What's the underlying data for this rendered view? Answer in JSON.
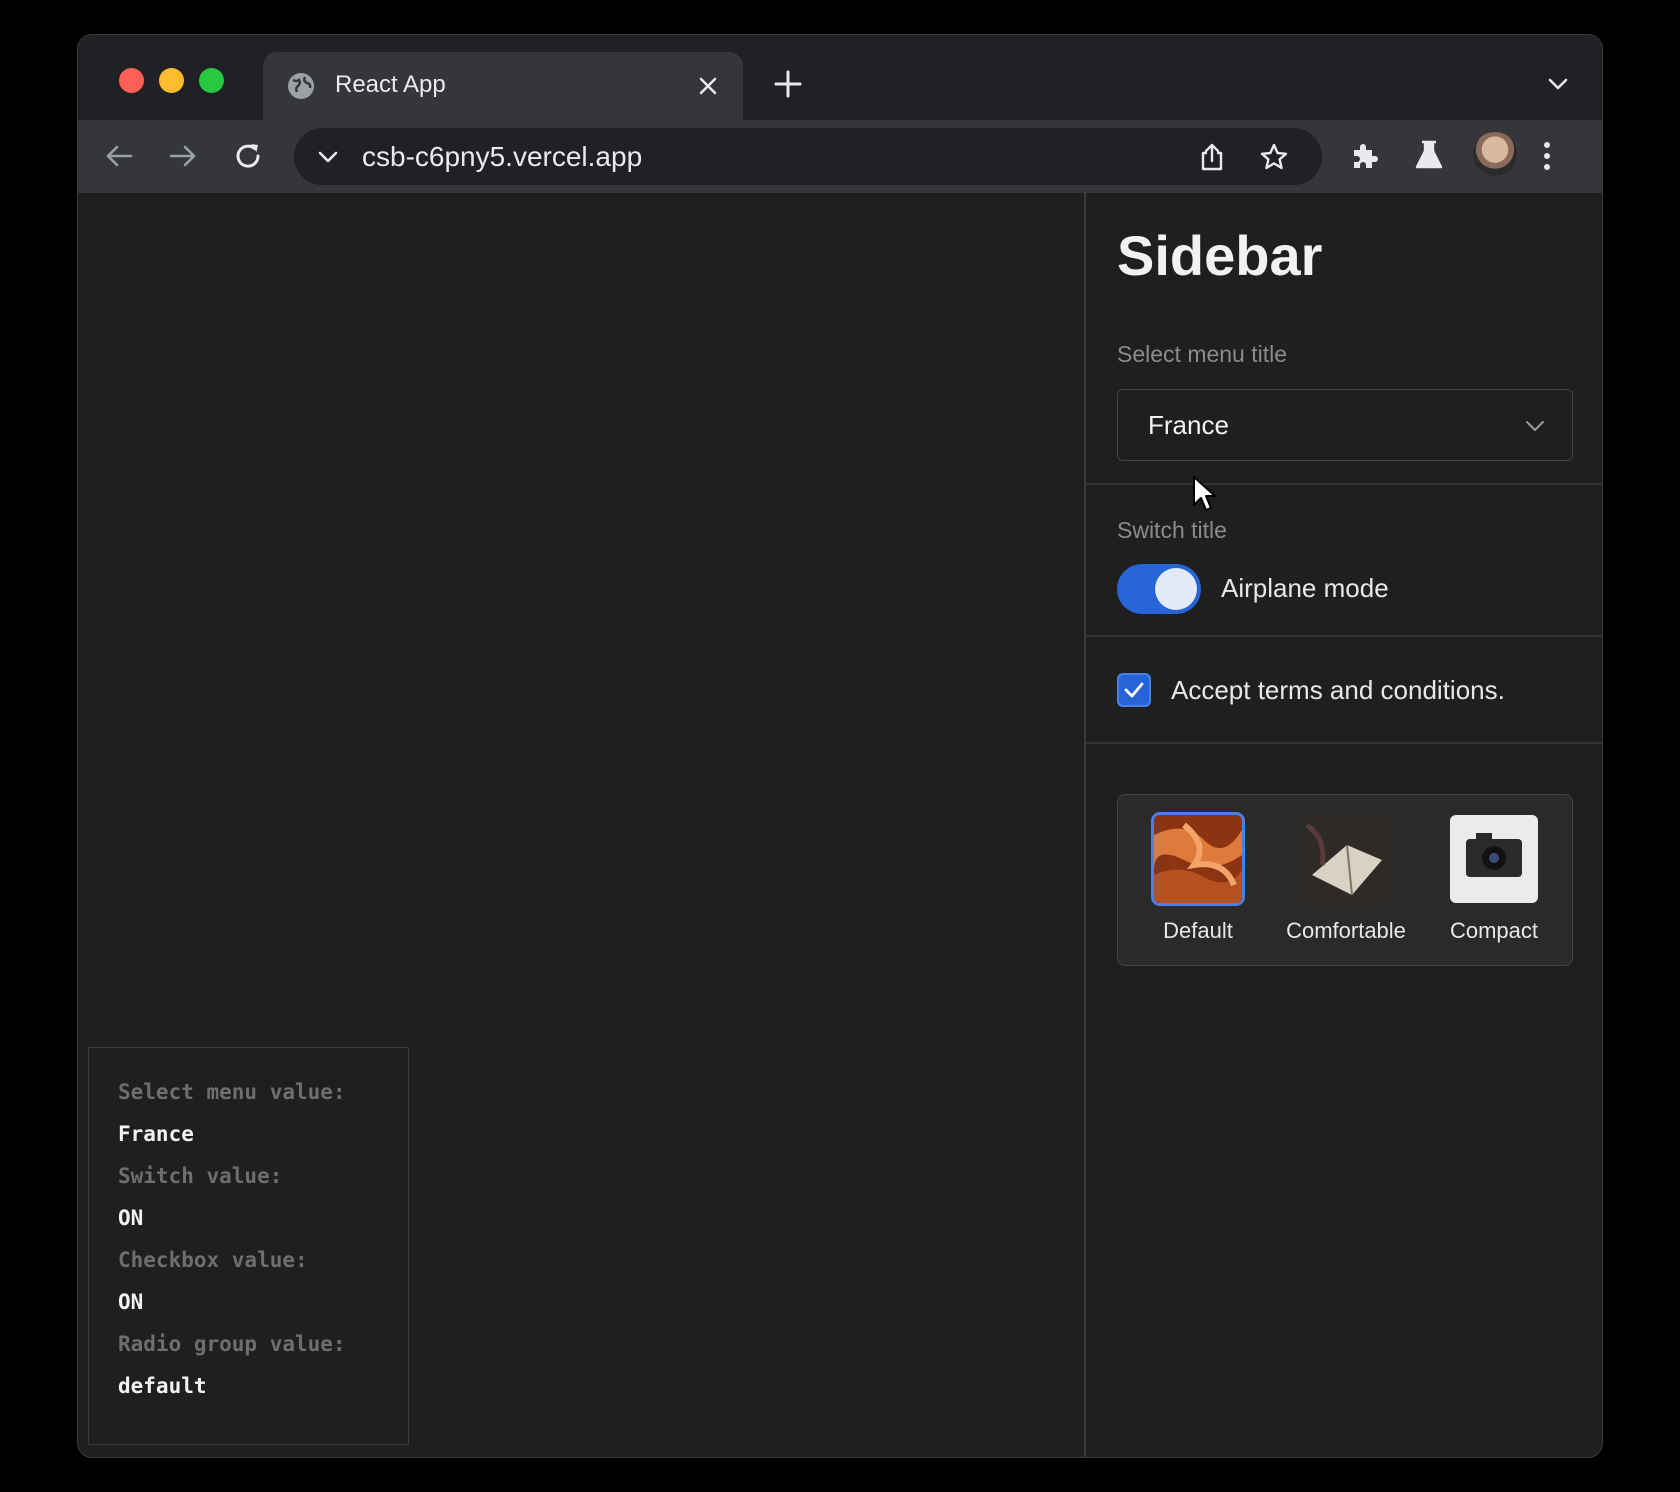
{
  "browser": {
    "tab_title": "React App",
    "url": "csb-c6pny5.vercel.app"
  },
  "sidebar": {
    "title": "Sidebar",
    "select": {
      "label": "Select menu title",
      "value": "France"
    },
    "switch": {
      "label": "Switch title",
      "text": "Airplane mode",
      "state": "on"
    },
    "checkbox": {
      "text": "Accept terms and conditions.",
      "checked": true
    },
    "radio_group": {
      "options": [
        {
          "label": "Default",
          "selected": true
        },
        {
          "label": "Comfortable",
          "selected": false
        },
        {
          "label": "Compact",
          "selected": false
        }
      ]
    }
  },
  "debug": {
    "select_key": "Select menu value:",
    "select_value": "France",
    "switch_key": "Switch value:",
    "switch_value": "ON",
    "checkbox_key": "Checkbox value:",
    "checkbox_value": "ON",
    "radio_key": "Radio group value:",
    "radio_value": "default"
  },
  "colors": {
    "accent": "#2764d8",
    "background": "#1f1f1f",
    "chrome": "#35363a"
  }
}
